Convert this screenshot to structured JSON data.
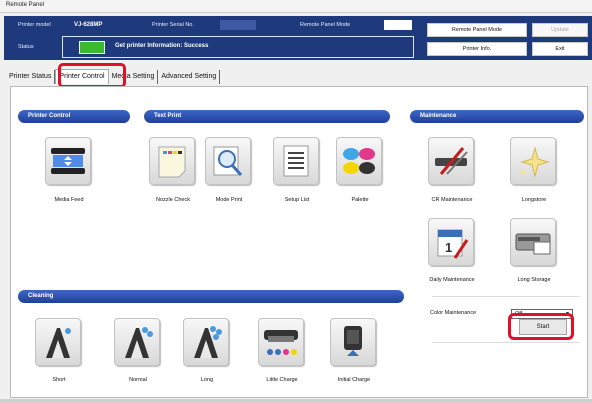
{
  "window": {
    "title": "Remote Panel"
  },
  "info": {
    "printer_model_label": "Printer model",
    "printer_model_value": "VJ-628MP",
    "serial_label": "Printer Serial No.",
    "mode_label": "Remote Panel Mode",
    "status_label": "Status",
    "status_text": "Get printer Information: Success",
    "status_color": "#3cba2b"
  },
  "top_buttons": {
    "remote_mode": "Remote Panel Mode",
    "update": "Update",
    "printer_info": "Printer Info.",
    "exit": "Exit"
  },
  "tabs": [
    {
      "label": "Printer Status"
    },
    {
      "label": "Printer Control"
    },
    {
      "label": "Media Setting"
    },
    {
      "label": "Advanced Setting"
    }
  ],
  "sections": {
    "printer_control": "Printer Control",
    "text_print": "Text Print",
    "maintenance": "Maintenance",
    "cleaning": "Cleaning"
  },
  "printer_control": {
    "media_feed": "Media Feed"
  },
  "text_print": {
    "nozzle_check": "Nozzle Check",
    "mode_print": "Mode Print",
    "setup_list": "Setup List",
    "palette": "Palette"
  },
  "maintenance": {
    "cr_maintenance": "CR Maintenance",
    "longstore": "Longstore",
    "daily_maintenance": "Daily Maintenance",
    "long_storage": "Long Storage",
    "color_maintenance_label": "Color Maintenance",
    "color_maintenance_value": "Off",
    "start": "Start"
  },
  "cleaning": {
    "short": "Short",
    "normal": "Normal",
    "long": "Long",
    "little_charge": "Little Charge",
    "initial_charge": "Initial Charge"
  }
}
